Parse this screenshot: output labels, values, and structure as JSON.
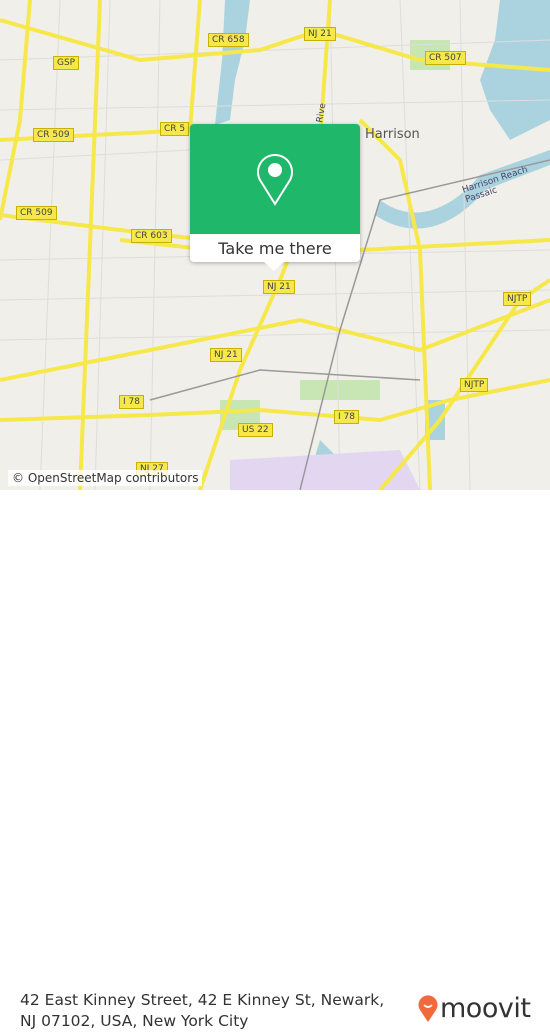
{
  "map": {
    "road_labels": [
      "CR 658",
      "NJ 21",
      "CR 507",
      "GSP",
      "CR 509",
      "CR 5",
      "CR 509",
      "CR 603",
      "NJ 21",
      "NJ 21",
      "NJTP",
      "NJTP",
      "I 78",
      "I 78",
      "US 22",
      "NJ 27"
    ],
    "place_labels": [
      "Harrison",
      "Harrison Reach Passaic",
      "Rive"
    ],
    "attribution": "© OpenStreetMap contributors",
    "colors": {
      "land": "#f1efe9",
      "road": "#f6e84a",
      "water": "#aad3df",
      "park": "#c8e6b4",
      "airport": "#e2d6f0"
    }
  },
  "popup": {
    "icon": "map-pin-icon",
    "button_label": "Take me there",
    "color": "#1fb86a"
  },
  "footer": {
    "address": "42 East Kinney Street, 42 E Kinney St, Newark, NJ 07102, USA, New York City",
    "logo_text": "moovit",
    "logo_color": "#f26a3c"
  }
}
